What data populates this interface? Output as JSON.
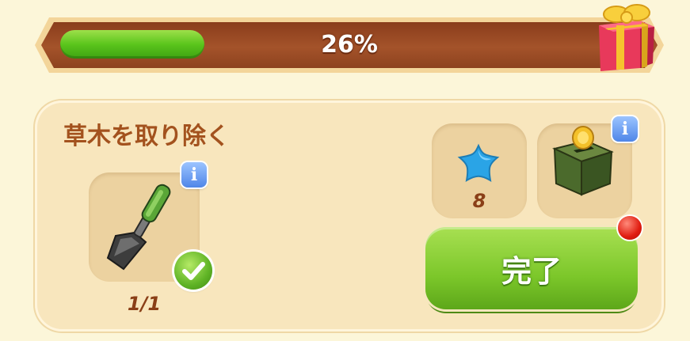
{
  "progress": {
    "percent": 26,
    "label": "26%"
  },
  "quest": {
    "title": "草木を取り除く",
    "tool": {
      "icon": "shovel-icon",
      "count": "1/1",
      "completed": true
    },
    "rewards": [
      {
        "icon": "blue-star-icon",
        "count": "8"
      },
      {
        "icon": "coin-chest-icon",
        "count": ""
      }
    ],
    "done_label": "完了",
    "info_glyph": "i"
  },
  "colors": {
    "progress_fill": "#5bc51c",
    "title": "#a3521e",
    "button": "#7cc72a",
    "alert": "#e01c10"
  }
}
